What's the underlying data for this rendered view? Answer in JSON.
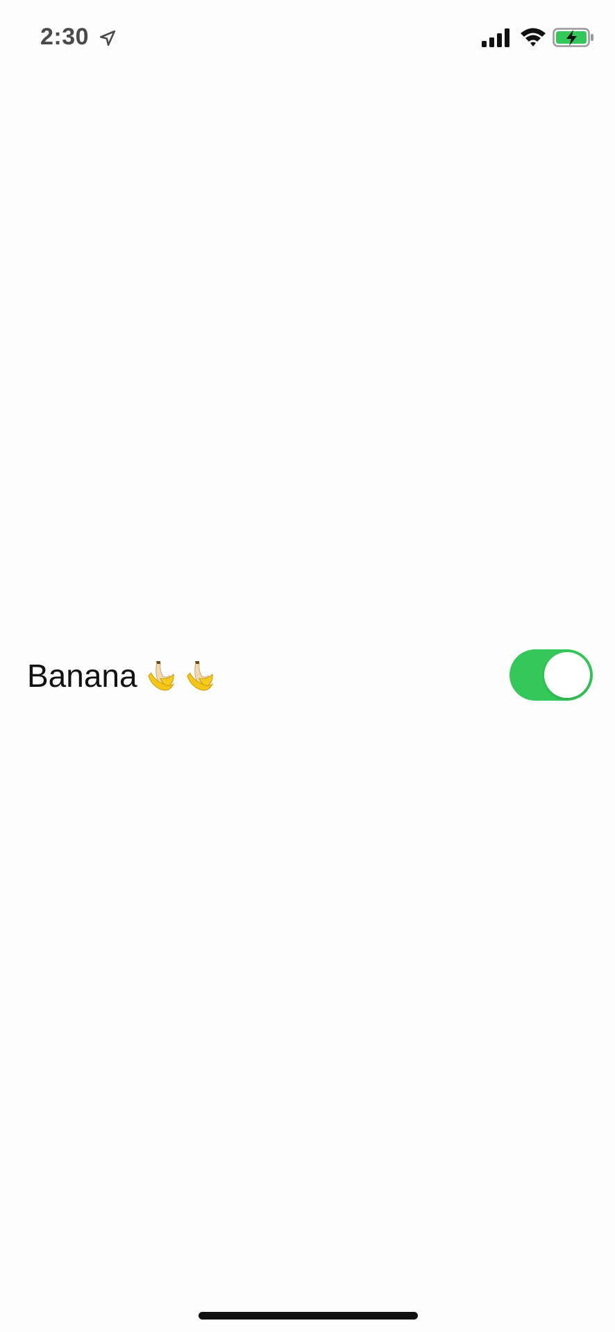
{
  "status_bar": {
    "time": "2:30",
    "icons": [
      "location-arrow-icon",
      "cellular-signal-icon",
      "wifi-icon",
      "battery-charging-icon"
    ],
    "battery_color": "#34c759"
  },
  "setting": {
    "label": "Banana",
    "emoji": [
      "banana-icon",
      "banana-icon"
    ],
    "toggle_on": true,
    "toggle_color": "#34c759"
  }
}
